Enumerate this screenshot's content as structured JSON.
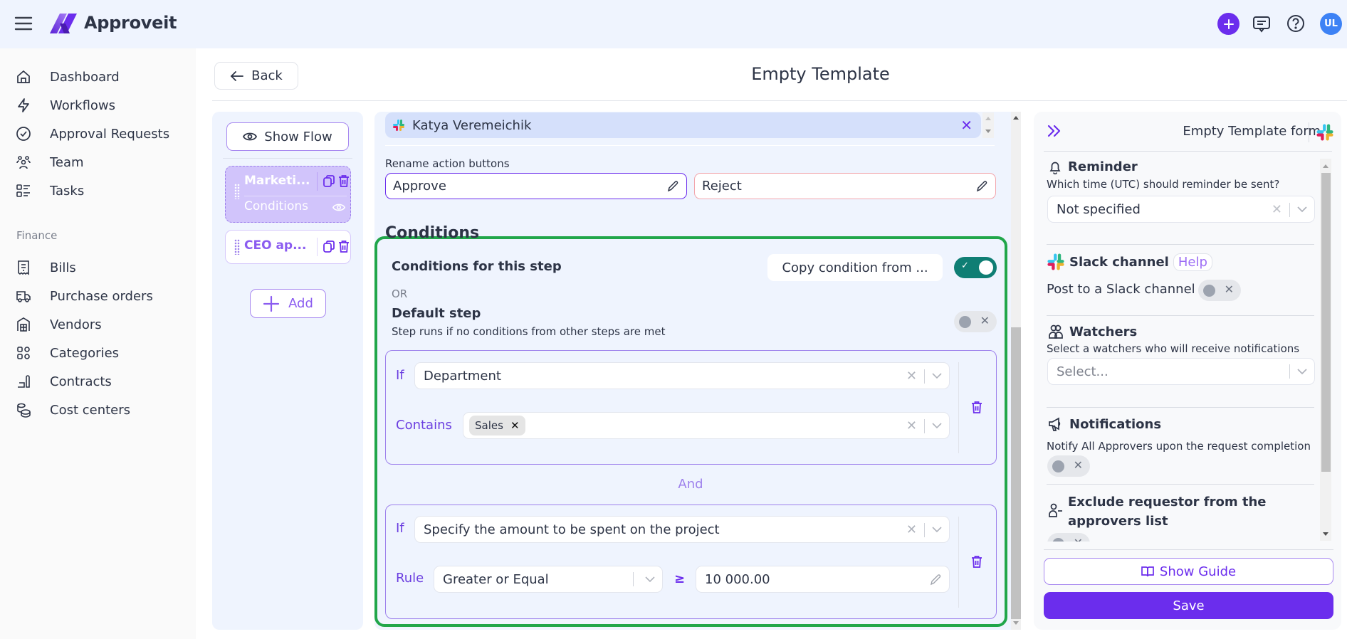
{
  "app": {
    "brand": "Approveit"
  },
  "header": {
    "avatar_initials": "UL",
    "icons": [
      "menu-icon",
      "plus-icon",
      "chat-icon",
      "help-icon"
    ]
  },
  "sidebar": {
    "items": [
      {
        "label": "Dashboard",
        "icon": "home-icon"
      },
      {
        "label": "Workflows",
        "icon": "bolt-icon"
      },
      {
        "label": "Approval Requests",
        "icon": "check-circle-icon"
      },
      {
        "label": "Team",
        "icon": "team-icon"
      },
      {
        "label": "Tasks",
        "icon": "tasks-icon"
      }
    ],
    "section_title": "Finance",
    "finance_items": [
      {
        "label": "Bills",
        "icon": "receipt-icon"
      },
      {
        "label": "Purchase orders",
        "icon": "truck-icon"
      },
      {
        "label": "Vendors",
        "icon": "store-icon"
      },
      {
        "label": "Categories",
        "icon": "grid-icon"
      },
      {
        "label": "Contracts",
        "icon": "contract-icon"
      },
      {
        "label": "Cost centers",
        "icon": "coins-icon"
      }
    ]
  },
  "page": {
    "back_label": "Back",
    "title": "Empty Template"
  },
  "steps": {
    "show_flow_label": "Show Flow",
    "items": [
      {
        "name": "Marketi...",
        "sub": "Conditions",
        "selected": true
      },
      {
        "name": "CEO ap...",
        "selected": false
      }
    ],
    "add_label": "Add"
  },
  "step_editor": {
    "approver": {
      "name": "Katya Veremeichik"
    },
    "rename_label": "Rename action buttons",
    "approve_value": "Approve",
    "reject_value": "Reject",
    "conditions": {
      "title": "Conditions",
      "for_step_label": "Conditions for this step",
      "copy_button": "Copy condition from ...",
      "conditions_enabled": true,
      "or_label": "OR",
      "default_title": "Default step",
      "default_sub": "Step runs if no conditions from other steps are met",
      "default_enabled": false,
      "rules": [
        {
          "if_label": "If",
          "field": "Department",
          "op_label": "Contains",
          "tags": [
            "Sales"
          ]
        },
        {
          "if_label": "If",
          "field": "Specify the amount to be spent on the project",
          "op_label": "Rule",
          "operator": "Greater or Equal",
          "symbol": "≥",
          "value": "10 000.00"
        }
      ],
      "join_label": "And"
    }
  },
  "right_panel": {
    "title": "Empty Template form",
    "reminder": {
      "title": "Reminder",
      "sub": "Which time (UTC) should reminder be sent?",
      "value": "Not specified"
    },
    "slack": {
      "title": "Slack channel",
      "help": "Help",
      "post_label": "Post to a Slack channel",
      "enabled": false
    },
    "watchers": {
      "title": "Watchers",
      "sub": "Select a watchers who will receive notifications",
      "placeholder": "Select..."
    },
    "notifications": {
      "title": "Notifications",
      "sub": "Notify All Approvers upon the request completion",
      "enabled": false
    },
    "exclude": {
      "title": "Exclude requestor from the approvers list",
      "enabled": false
    },
    "show_guide": "Show Guide",
    "save": "Save"
  },
  "colors": {
    "accent": "#6b2ded",
    "toggle_on": "#0f7e74",
    "highlight_border": "#21a64a",
    "avatar": "#3d82f5"
  }
}
